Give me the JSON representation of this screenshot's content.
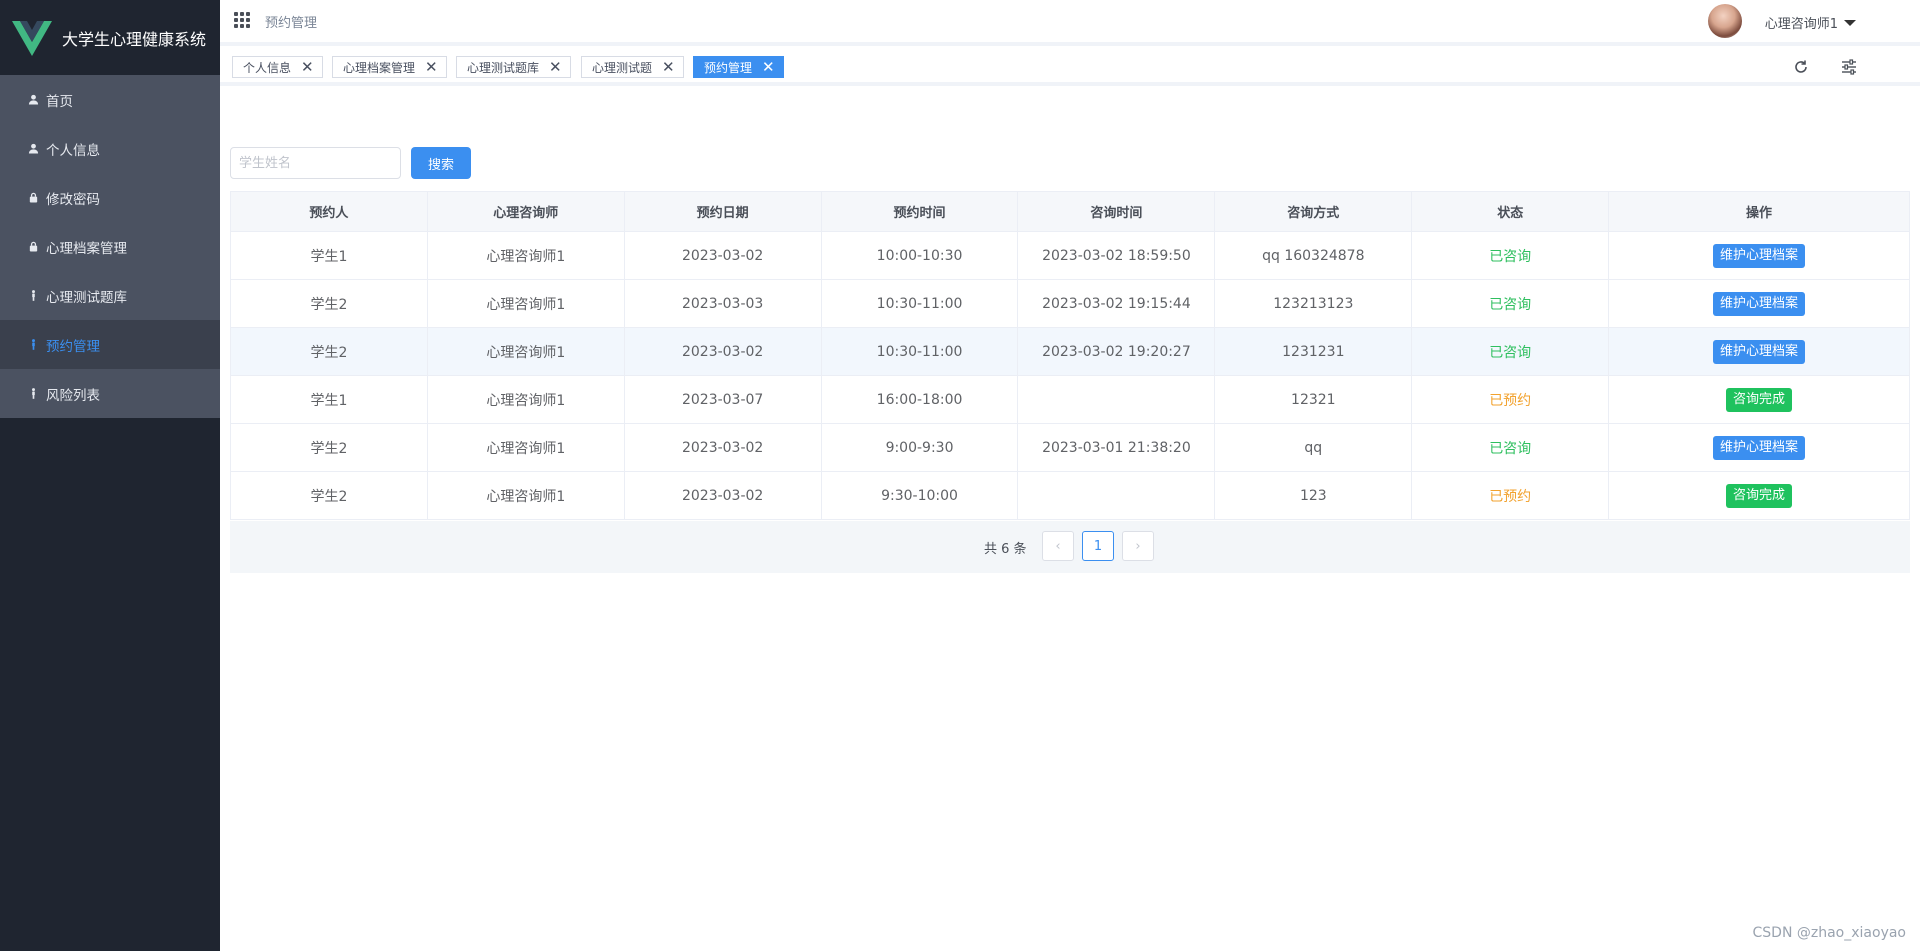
{
  "app": {
    "title": "大学生心理健康系统",
    "brand_color": "#3b8ff0"
  },
  "sidebar": {
    "items": [
      {
        "label": "首页",
        "icon": "user-icon"
      },
      {
        "label": "个人信息",
        "icon": "user-icon"
      },
      {
        "label": "修改密码",
        "icon": "lock-icon"
      },
      {
        "label": "心理档案管理",
        "icon": "lock-icon"
      },
      {
        "label": "心理测试题库",
        "icon": "person-icon"
      },
      {
        "label": "预约管理",
        "icon": "person-icon",
        "active": true
      },
      {
        "label": "风险列表",
        "icon": "person-icon"
      }
    ]
  },
  "header": {
    "breadcrumb": "预约管理",
    "user_name": "心理咨询师1"
  },
  "tags": [
    {
      "label": "个人信息"
    },
    {
      "label": "心理档案管理"
    },
    {
      "label": "心理测试题库"
    },
    {
      "label": "心理测试题"
    },
    {
      "label": "预约管理",
      "active": true
    }
  ],
  "search": {
    "placeholder": "学生姓名",
    "button": "搜索"
  },
  "table": {
    "headers": [
      "预约人",
      "心理咨询师",
      "预约日期",
      "预约时间",
      "咨询时间",
      "咨询方式",
      "状态",
      "操作"
    ],
    "rows": [
      {
        "cells": [
          "学生1",
          "心理咨询师1",
          "2023-03-02",
          "10:00-10:30",
          "2023-03-02 18:59:50",
          "qq 160324878"
        ],
        "status": "已咨询",
        "action": "维护心理档案"
      },
      {
        "cells": [
          "学生2",
          "心理咨询师1",
          "2023-03-03",
          "10:30-11:00",
          "2023-03-02 19:15:44",
          "123213123"
        ],
        "status": "已咨询",
        "action": "维护心理档案"
      },
      {
        "cells": [
          "学生2",
          "心理咨询师1",
          "2023-03-02",
          "10:30-11:00",
          "2023-03-02 19:20:27",
          "1231231"
        ],
        "status": "已咨询",
        "action": "维护心理档案"
      },
      {
        "cells": [
          "学生1",
          "心理咨询师1",
          "2023-03-07",
          "16:00-18:00",
          "",
          "12321"
        ],
        "status": "已预约",
        "action": "咨询完成"
      },
      {
        "cells": [
          "学生2",
          "心理咨询师1",
          "2023-03-02",
          "9:00-9:30",
          "2023-03-01 21:38:20",
          "qq"
        ],
        "status": "已咨询",
        "action": "维护心理档案"
      },
      {
        "cells": [
          "学生2",
          "心理咨询师1",
          "2023-03-02",
          "9:30-10:00",
          "",
          "123"
        ],
        "status": "已预约",
        "action": "咨询完成"
      }
    ]
  },
  "pagination": {
    "total_text": "共 6 条",
    "current_page": "1"
  },
  "watermark": "CSDN @zhao_xiaoyao"
}
